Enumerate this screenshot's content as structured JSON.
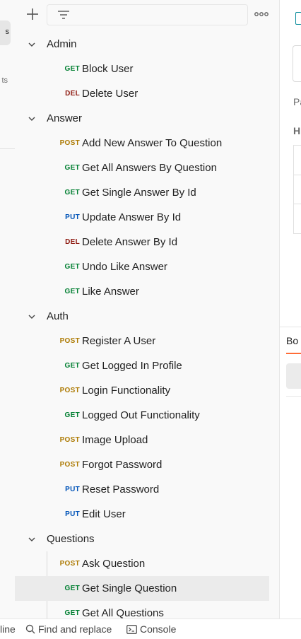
{
  "left_strip": {
    "tab_fragment": "s",
    "text_fragment": "ts"
  },
  "toolbar": {
    "add_icon": "plus-icon",
    "filter_icon": "filter-icon",
    "filter_placeholder": "",
    "more_icon": "more-horizontal-icon"
  },
  "tree": [
    {
      "kind": "folder",
      "label": "Admin"
    },
    {
      "kind": "request",
      "method": "GET",
      "label": "Block User"
    },
    {
      "kind": "request",
      "method": "DEL",
      "label": "Delete User"
    },
    {
      "kind": "folder",
      "label": "Answer"
    },
    {
      "kind": "request",
      "method": "POST",
      "label": "Add New Answer To Question"
    },
    {
      "kind": "request",
      "method": "GET",
      "label": "Get All Answers By Question"
    },
    {
      "kind": "request",
      "method": "GET",
      "label": "Get Single Answer By Id"
    },
    {
      "kind": "request",
      "method": "PUT",
      "label": "Update Answer By Id"
    },
    {
      "kind": "request",
      "method": "DEL",
      "label": "Delete Answer By Id"
    },
    {
      "kind": "request",
      "method": "GET",
      "label": "Undo Like Answer"
    },
    {
      "kind": "request",
      "method": "GET",
      "label": "Like Answer"
    },
    {
      "kind": "folder",
      "label": "Auth"
    },
    {
      "kind": "request",
      "method": "POST",
      "label": "Register A User"
    },
    {
      "kind": "request",
      "method": "GET",
      "label": "Get Logged In Profile"
    },
    {
      "kind": "request",
      "method": "POST",
      "label": "Login Functionality"
    },
    {
      "kind": "request",
      "method": "GET",
      "label": "Logged Out Functionality"
    },
    {
      "kind": "request",
      "method": "POST",
      "label": "Image Upload"
    },
    {
      "kind": "request",
      "method": "POST",
      "label": "Forgot Password"
    },
    {
      "kind": "request",
      "method": "PUT",
      "label": "Reset Password"
    },
    {
      "kind": "request",
      "method": "PUT",
      "label": "Edit User"
    },
    {
      "kind": "folder",
      "label": "Questions"
    },
    {
      "kind": "request",
      "method": "POST",
      "label": "Ask Question"
    },
    {
      "kind": "request",
      "method": "GET",
      "label": "Get Single Question",
      "selected": true
    },
    {
      "kind": "request",
      "method": "GET",
      "label": "Get All Questions"
    }
  ],
  "method_colors": {
    "GET": "#007f31",
    "POST": "#ad7a03",
    "PUT": "#0053b8",
    "DEL": "#8e1a10"
  },
  "right_panel": {
    "params_fragment": "Pa",
    "headers_fragment": "H",
    "body_tab_fragment": "Bo",
    "accent": "#ff6c37"
  },
  "statusbar": {
    "online_fragment": "line",
    "find_replace": "Find and replace",
    "console": "Console"
  }
}
